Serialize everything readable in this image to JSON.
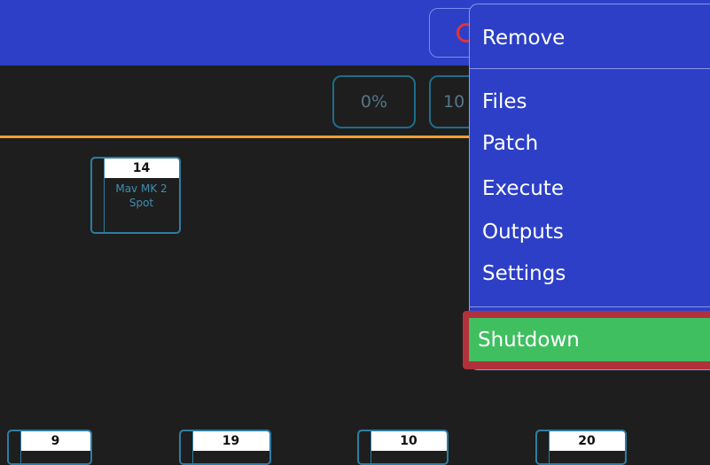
{
  "toolbar": {
    "percent_0": "0%",
    "percent_100_partial": "10"
  },
  "fixtures": [
    {
      "number": "14",
      "name_line1": "Mav MK 2",
      "name_line2": "Spot"
    },
    {
      "number": "9"
    },
    {
      "number": "19"
    },
    {
      "number": "10"
    },
    {
      "number": "20"
    }
  ],
  "menu": {
    "remove": "Remove",
    "files": "Files",
    "patch": "Patch",
    "execute": "Execute",
    "outputs": "Outputs",
    "settings": "Settings",
    "shutdown": "Shutdown"
  },
  "colors": {
    "accent_blue": "#2c3fc6",
    "shutdown_green": "#3fbf5f",
    "highlight_red": "#b0313b",
    "divider_orange": "#f0a032",
    "power_icon_red": "#e1343b"
  },
  "icons": {
    "topbar_button": "power-icon"
  }
}
